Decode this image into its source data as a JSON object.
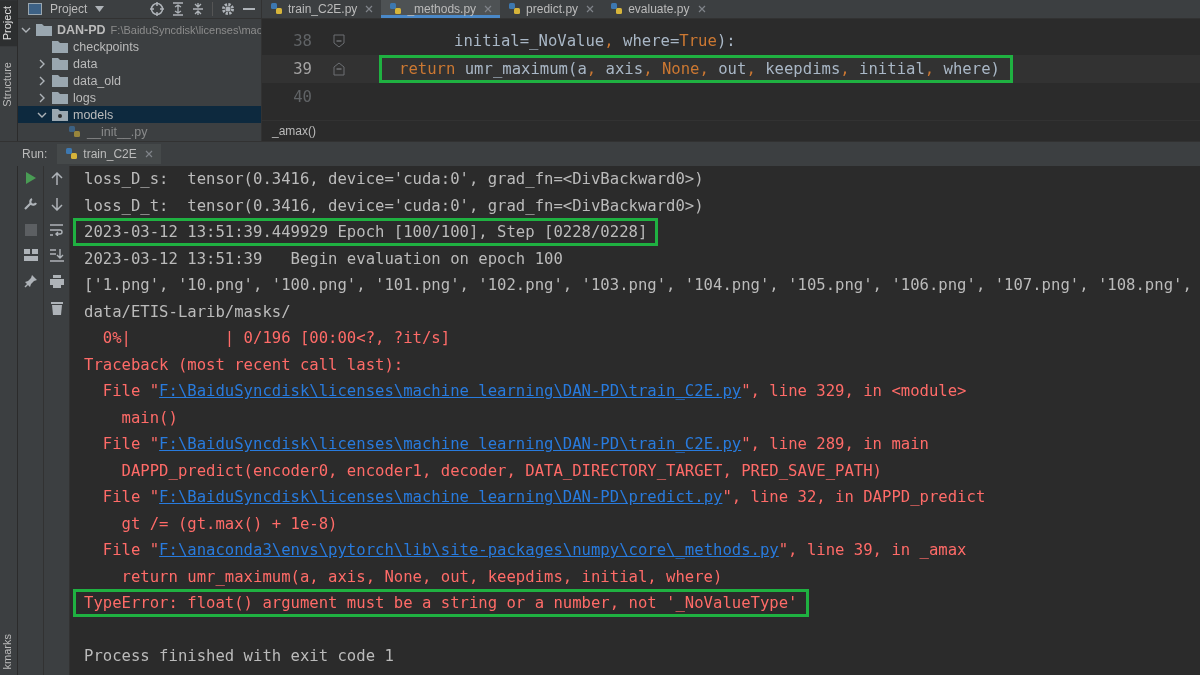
{
  "side_strip": {
    "top": [
      "Project",
      "Structure"
    ],
    "bottom": "kmarks"
  },
  "project_panel": {
    "title": "Project",
    "tree": [
      {
        "label": "DAN-PD",
        "path": "F:\\BaiduSyncdisk\\licenses\\mac",
        "expanded": true,
        "selected": false,
        "kind": "folder",
        "children": [
          {
            "label": "checkpoints",
            "selected": false,
            "kind": "folder"
          },
          {
            "label": "data",
            "expanded": false,
            "selected": false,
            "kind": "folder"
          },
          {
            "label": "data_old",
            "expanded": false,
            "selected": false,
            "kind": "folder"
          },
          {
            "label": "logs",
            "expanded": false,
            "selected": false,
            "kind": "folder"
          },
          {
            "label": "models",
            "expanded": true,
            "selected": true,
            "kind": "package",
            "children": [
              {
                "label": "__init__.py",
                "selected": false,
                "kind": "python-file"
              }
            ]
          }
        ]
      }
    ]
  },
  "editor": {
    "tabs": [
      {
        "label": "train_C2E.py",
        "selected": false
      },
      {
        "label": "_methods.py",
        "selected": true
      },
      {
        "label": "predict.py",
        "selected": false
      },
      {
        "label": "evaluate.py",
        "selected": false
      }
    ],
    "lines": [
      {
        "number": "38",
        "boxed": false,
        "current": false,
        "tokens": [
          {
            "kind": "plain",
            "text": "initial=_NoValue"
          },
          {
            "kind": "keyword",
            "text": ", "
          },
          {
            "kind": "plain",
            "text": "where="
          },
          {
            "kind": "keyword",
            "text": "True"
          },
          {
            "kind": "plain",
            "text": "):"
          }
        ]
      },
      {
        "number": "39",
        "boxed": true,
        "current": true,
        "tokens": [
          {
            "kind": "keyword",
            "text": "return "
          },
          {
            "kind": "plain",
            "text": "umr_maximum(a"
          },
          {
            "kind": "keyword",
            "text": ", "
          },
          {
            "kind": "plain",
            "text": "axis"
          },
          {
            "kind": "keyword",
            "text": ", None, "
          },
          {
            "kind": "plain",
            "text": "out"
          },
          {
            "kind": "keyword",
            "text": ", "
          },
          {
            "kind": "plain",
            "text": "keepdims"
          },
          {
            "kind": "keyword",
            "text": ", "
          },
          {
            "kind": "plain",
            "text": "initial"
          },
          {
            "kind": "keyword",
            "text": ", "
          },
          {
            "kind": "plain",
            "text": "where)"
          }
        ]
      },
      {
        "number": "40",
        "current": false
      }
    ],
    "breadcrumb": "_amax()"
  },
  "run_panel": {
    "label": "Run:",
    "tab": "train_C2E",
    "console": [
      {
        "kind": "out",
        "boxed": false,
        "text": "loss_D_s:  tensor(0.3416, device='cuda:0', grad_fn=<DivBackward0>)"
      },
      {
        "kind": "out",
        "boxed": false,
        "text": "loss_D_t:  tensor(0.3416, device='cuda:0', grad_fn=<DivBackward0>)"
      },
      {
        "kind": "out",
        "boxed": true,
        "text": "2023-03-12 13:51:39.449929 Epoch [100/100], Step [0228/0228]"
      },
      {
        "kind": "out",
        "boxed": false,
        "text": "2023-03-12 13:51:39   Begin evaluation on epoch 100"
      },
      {
        "kind": "out",
        "boxed": false,
        "text": "['1.png', '10.png', '100.png', '101.png', '102.png', '103.png', '104.png', '105.png', '106.png', '107.png', '108.png',"
      },
      {
        "kind": "out",
        "boxed": false,
        "text": "data/ETIS-Larib/masks/"
      },
      {
        "kind": "err",
        "boxed": false,
        "text": "  0%|          | 0/196 [00:00<?, ?it/s]"
      },
      {
        "kind": "err",
        "boxed": false,
        "text": "Traceback (most recent call last):"
      },
      {
        "kind": "file",
        "boxed": false,
        "prefix": "  File \"",
        "path": "F:\\BaiduSyncdisk\\licenses\\machine learning\\DAN-PD\\train_C2E.py",
        "suffix": "\", line 329, in <module>"
      },
      {
        "kind": "err",
        "boxed": false,
        "text": "    main()"
      },
      {
        "kind": "file",
        "boxed": false,
        "prefix": "  File \"",
        "path": "F:\\BaiduSyncdisk\\licenses\\machine learning\\DAN-PD\\train_C2E.py",
        "suffix": "\", line 289, in main"
      },
      {
        "kind": "err",
        "boxed": false,
        "text": "    DAPPD_predict(encoder0, encoder1, decoder, DATA_DIRECTORY_TARGET, PRED_SAVE_PATH)"
      },
      {
        "kind": "file",
        "boxed": false,
        "prefix": "  File \"",
        "path": "F:\\BaiduSyncdisk\\licenses\\machine learning\\DAN-PD\\predict.py",
        "suffix": "\", line 32, in DAPPD_predict"
      },
      {
        "kind": "err",
        "boxed": false,
        "text": "    gt /= (gt.max() + 1e-8)"
      },
      {
        "kind": "file",
        "boxed": false,
        "prefix": "  File \"",
        "path": "F:\\anaconda3\\envs\\pytorch\\lib\\site-packages\\numpy\\core\\_methods.py",
        "suffix": "\", line 39, in _amax"
      },
      {
        "kind": "err",
        "boxed": false,
        "text": "    return umr_maximum(a, axis, None, out, keepdims, initial, where)"
      },
      {
        "kind": "err",
        "boxed": true,
        "text": "TypeError: float() argument must be a string or a number, not '_NoValueType'"
      },
      {
        "kind": "blank"
      },
      {
        "kind": "out",
        "boxed": false,
        "text": "Process finished with exit code 1"
      }
    ]
  }
}
